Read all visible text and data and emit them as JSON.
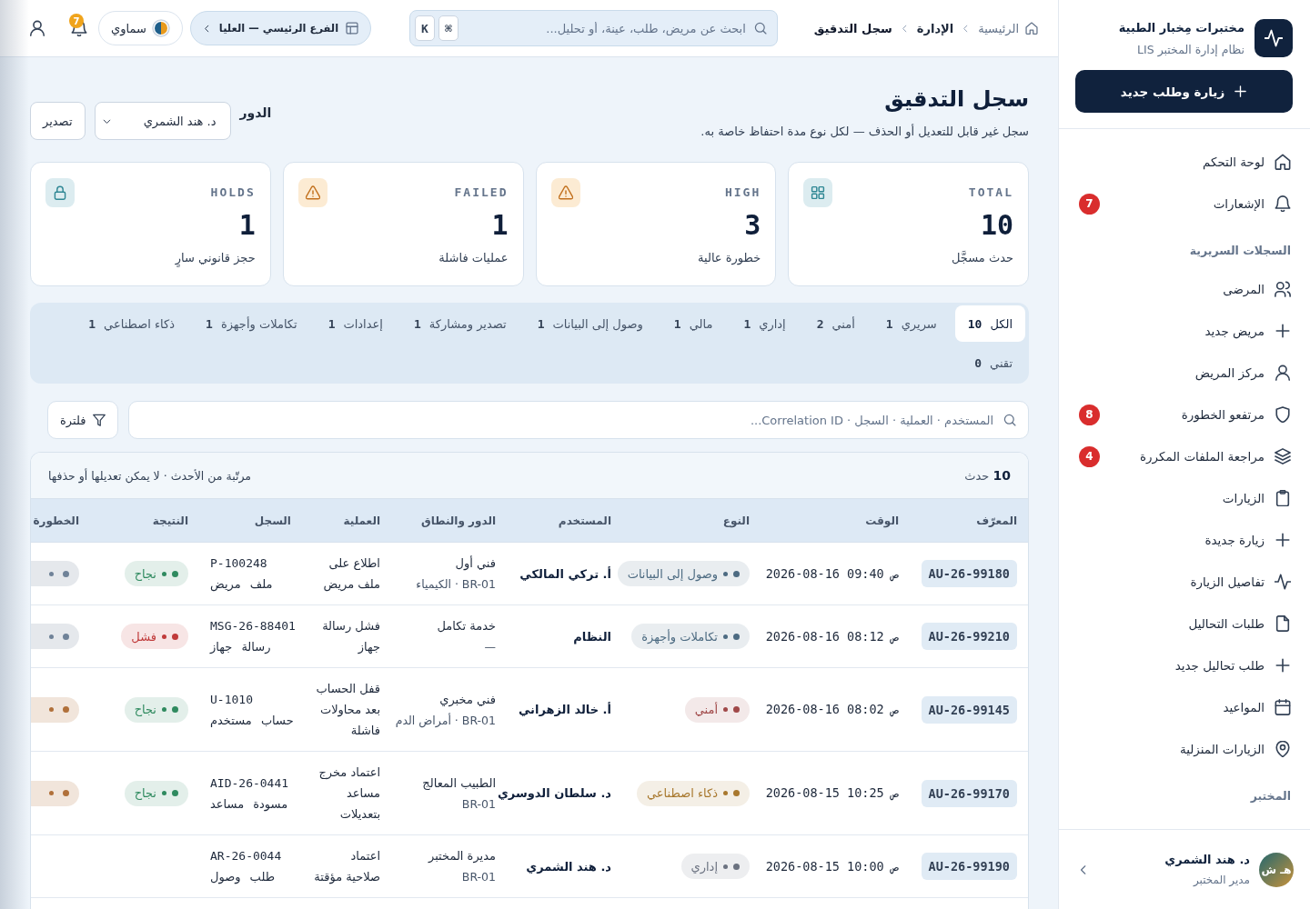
{
  "header": {
    "breadcrumb": [
      {
        "label": "الرئيسية",
        "kind": "home"
      },
      {
        "label": "الإدارة",
        "kind": "link"
      },
      {
        "label": "سجل التدقيق",
        "kind": "current"
      }
    ],
    "search": {
      "placeholder": "ابحث عن مريض، طلب، عينة، أو تحليل...",
      "keys": [
        "⌘",
        "K"
      ]
    },
    "branch": {
      "label": "الفرع الرئيسي — العليا"
    },
    "theme": {
      "label": "سماوي"
    },
    "notifications": {
      "count": "7"
    }
  },
  "page": {
    "title": "سجل التدقيق",
    "subtitle": "سجل غير قابل للتعديل أو الحذف — لكل نوع مدة احتفاظ خاصة به.",
    "role_label": "الدور",
    "role_value": "د. هند الشمري",
    "export_button": "تصدير"
  },
  "stats": [
    {
      "kind": "grid",
      "label": "TOTAL",
      "value": "10",
      "caption": "حدث مسجَّل"
    },
    {
      "kind": "warning",
      "label": "HIGH",
      "value": "3",
      "caption": "خطورة عالية"
    },
    {
      "kind": "warning",
      "label": "FAILED",
      "value": "1",
      "caption": "عمليات فاشلة"
    },
    {
      "kind": "lock",
      "label": "HOLDS",
      "value": "1",
      "caption": "حجز قانوني سارٍ"
    }
  ],
  "tabs": [
    {
      "label": "الكل",
      "count": "10",
      "selected": true
    },
    {
      "label": "سريري",
      "count": "1",
      "selected": false
    },
    {
      "label": "أمني",
      "count": "2",
      "selected": false
    },
    {
      "label": "إداري",
      "count": "1",
      "selected": false
    },
    {
      "label": "مالي",
      "count": "1",
      "selected": false
    },
    {
      "label": "وصول إلى البيانات",
      "count": "1",
      "selected": false
    },
    {
      "label": "تصدير ومشاركة",
      "count": "1",
      "selected": false
    },
    {
      "label": "إعدادات",
      "count": "1",
      "selected": false
    },
    {
      "label": "تكاملات وأجهزة",
      "count": "1",
      "selected": false
    },
    {
      "label": "ذكاء اصطناعي",
      "count": "1",
      "selected": false
    },
    {
      "label": "تقني",
      "count": "0",
      "selected": false
    }
  ],
  "filters": {
    "search": {
      "placeholder": "المستخدم · العملية · السجل · Correlation ID..."
    },
    "filter_button": "فلترة"
  },
  "table": {
    "count": "**10** حدث",
    "note": "مرتّبة من الأحدث · لا يمكن تعديلها أو حذفها",
    "columns": [
      "المعرّف",
      "الوقت",
      "النوع",
      "المستخدم",
      "الدور والنطاق",
      "العملية",
      "السجل",
      "النتيجة",
      "الخطورة"
    ],
    "rows": [
      {
        "id": "AU-26-99180",
        "time": "2026-08-16 09:40 ص",
        "type": {
          "label": "وصول إلى البيانات",
          "color": "#4d6b82"
        },
        "user": "أ. تركي المالكي",
        "role": "فني أول",
        "scope": "BR-01 · الكيمياء",
        "operation": "اطلاع على ملف مريض",
        "record_id": "P-100248",
        "record_type": "ملف مريض",
        "result": {
          "label": "نجاح",
          "color": "#2f8a5f"
        },
        "severity": {
          "color": "#6f8298"
        }
      },
      {
        "id": "AU-26-99210",
        "time": "2026-08-16 08:12 ص",
        "type": {
          "label": "تكاملات وأجهزة",
          "color": "#4d6b82"
        },
        "user": "النظام",
        "role": "خدمة تكامل",
        "scope": "—",
        "operation": "فشل رسالة جهاز",
        "record_id": "MSG-26-88401",
        "record_type": "رسالة جهاز",
        "result": {
          "label": "فشل",
          "color": "#c03a3a"
        },
        "severity": {
          "color": "#6f8298"
        }
      },
      {
        "id": "AU-26-99145",
        "time": "2026-08-16 08:02 ص",
        "type": {
          "label": "أمني",
          "color": "#a04848"
        },
        "user": "أ. خالد الزهراني",
        "role": "فني مخبري",
        "scope": "BR-01 · أمراض الدم",
        "operation": "قفل الحساب بعد محاولات فاشلة",
        "record_id": "U-1010",
        "record_type": "حساب مستخدم",
        "result": {
          "label": "نجاح",
          "color": "#2f8a5f"
        },
        "severity": {
          "color": "#b0703a"
        }
      },
      {
        "id": "AU-26-99170",
        "time": "2026-08-15 10:25 ص",
        "type": {
          "label": "ذكاء اصطناعي",
          "color": "#a8782e"
        },
        "user": "د. سلطان الدوسري",
        "role": "الطبيب المعالج",
        "scope": "BR-01",
        "operation": "اعتماد مخرج مساعد بتعديلات",
        "record_id": "AID-26-0441",
        "record_type": "مسودة مساعد",
        "result": {
          "label": "نجاح",
          "color": "#2f8a5f"
        },
        "severity": {
          "color": "#b0703a"
        }
      },
      {
        "id": "AU-26-99190",
        "time": "2026-08-15 10:00 ص",
        "type": {
          "label": "إداري",
          "color": "#6b7280"
        },
        "user": "د. هند الشمري",
        "role": "مديرة المختبر",
        "scope": "BR-01",
        "operation": "اعتماد صلاحية مؤقتة",
        "record_id": "AR-26-0044",
        "record_type": "طلب وصول"
      }
    ]
  },
  "sidebar": {
    "brand": {
      "name": "مختبرات مِخبار الطبية",
      "subtitle": "نظام إدارة المختبر LIS"
    },
    "new_button": "زيارة وطلب جديد",
    "nav": [
      {
        "kind": "home",
        "label": "لوحة التحكم"
      },
      {
        "kind": "bell",
        "label": "الإشعارات",
        "badge": "7"
      },
      {
        "kind": "section",
        "label": "السجلات السريرية"
      },
      {
        "kind": "users",
        "label": "المرضى"
      },
      {
        "kind": "plus",
        "label": "مريض جديد"
      },
      {
        "kind": "user",
        "label": "مركز المريض"
      },
      {
        "kind": "shield",
        "label": "مرتفعو الخطورة",
        "badge": "8"
      },
      {
        "kind": "layers",
        "label": "مراجعة الملفات المكررة",
        "badge": "4"
      },
      {
        "kind": "clipboard",
        "label": "الزيارات"
      },
      {
        "kind": "plus",
        "label": "زيارة جديدة"
      },
      {
        "kind": "pulse",
        "label": "تفاصيل الزيارة"
      },
      {
        "kind": "file",
        "label": "طلبات التحاليل"
      },
      {
        "kind": "plus",
        "label": "طلب تحاليل جديد"
      },
      {
        "kind": "calendar",
        "label": "المواعيد"
      },
      {
        "kind": "pin",
        "label": "الزيارات المنزلية"
      },
      {
        "kind": "section",
        "label": "المختبر"
      }
    ],
    "user": {
      "initials": "هـ ش",
      "name": "د. هند الشمري",
      "role": "مدير المختبر"
    }
  }
}
